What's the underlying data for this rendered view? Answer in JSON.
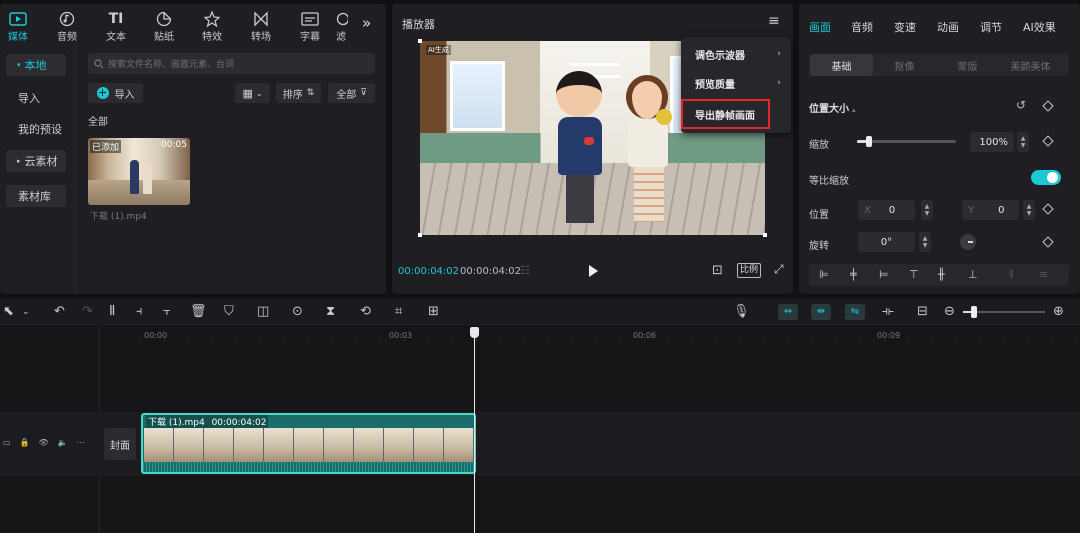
{
  "media_tabs": [
    {
      "label": "媒体",
      "icon": "media-icon"
    },
    {
      "label": "音频",
      "icon": "audio-icon"
    },
    {
      "label": "文本",
      "icon": "text-icon"
    },
    {
      "label": "贴纸",
      "icon": "sticker-icon"
    },
    {
      "label": "特效",
      "icon": "effects-icon"
    },
    {
      "label": "转场",
      "icon": "transition-icon"
    },
    {
      "label": "字幕",
      "icon": "subtitle-icon"
    },
    {
      "label": "滤",
      "icon": "filter-icon"
    }
  ],
  "media_nav": {
    "local": "本地",
    "import": "导入",
    "presets": "我的预设",
    "cloud": "云素材",
    "library": "素材库"
  },
  "media_panel": {
    "search_placeholder": "搜索文件名称、画面元素、台词",
    "import_button": "导入",
    "sort_button": "排序",
    "filter_button": "全部",
    "section_all": "全部",
    "clip_badge": "已添加",
    "clip_duration": "00:05",
    "clip_name": "下载 (1).mp4"
  },
  "player": {
    "title": "播放器",
    "time_current": "00:00:04:02",
    "time_total": "00:00:04:02",
    "ratio_button": "比例",
    "watermark": "AI生成"
  },
  "player_menu": {
    "items": [
      "调色示波器",
      "预览质量",
      "导出静帧画面"
    ],
    "highlighted": "导出静帧画面",
    "highlight_color": "#e0262b"
  },
  "right_panel": {
    "tabs": [
      "画面",
      "音频",
      "变速",
      "动画",
      "调节",
      "AI效果"
    ],
    "subtabs": [
      "基础",
      "抠像",
      "蒙版",
      "美颜美体"
    ],
    "section_title": "位置大小",
    "scale_label": "缩放",
    "scale_value": "100%",
    "scale_level": 0.12,
    "uniform_label": "等比缩放",
    "uniform_on": true,
    "position_label": "位置",
    "pos_x_label": "X",
    "pos_x_value": "0",
    "pos_y_label": "Y",
    "pos_y_value": "0",
    "rotation_label": "旋转",
    "rotation_value": "0°"
  },
  "timeline": {
    "ruler": [
      "00:00",
      "00:03",
      "00:06",
      "00:09"
    ],
    "cover_label": "封面",
    "clip_name": "下载 (1).mp4",
    "clip_duration": "00:00:04:02"
  },
  "colors": {
    "accent": "#1ec8d3",
    "clip_border": "#4fd6c9",
    "clip_bg": "#1a6c6a"
  }
}
